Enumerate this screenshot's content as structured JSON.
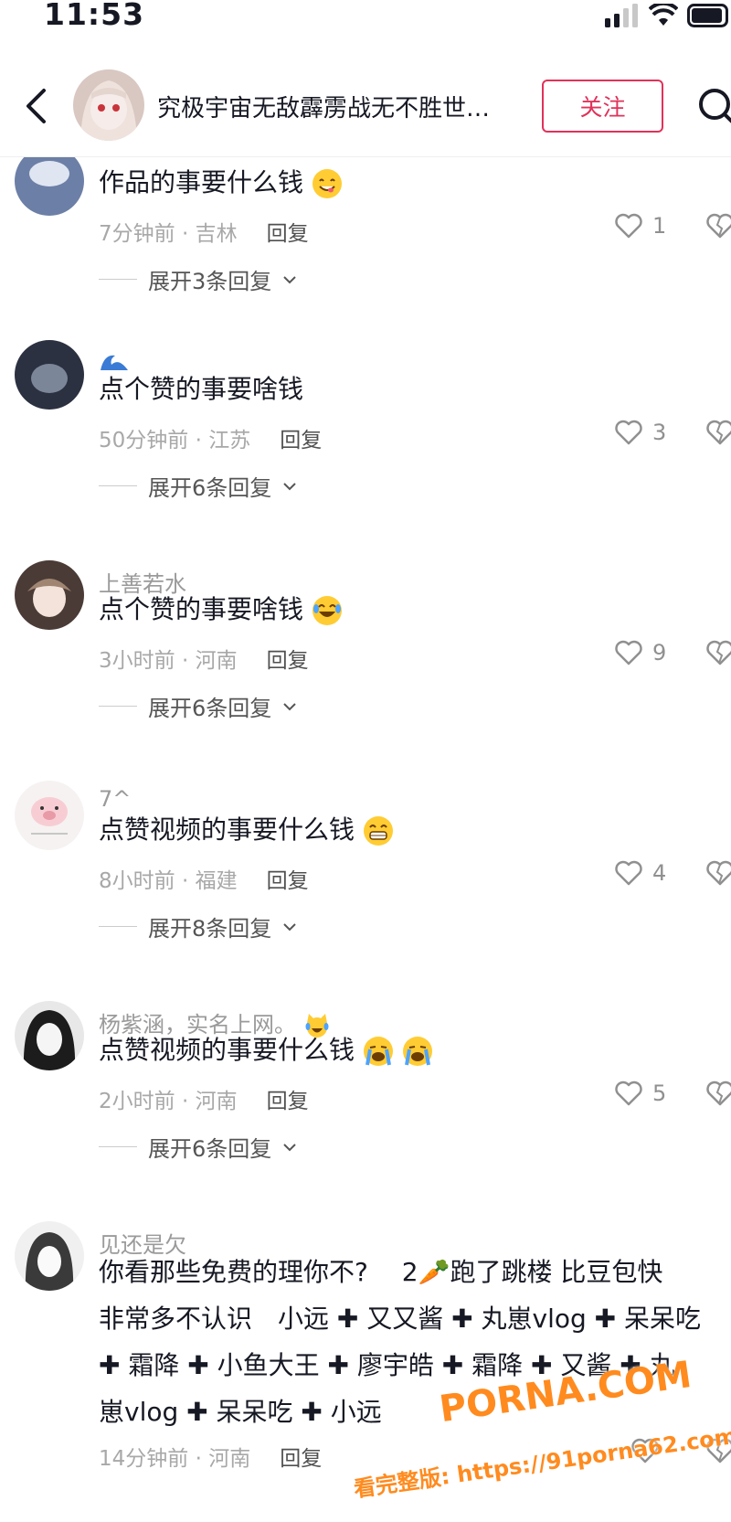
{
  "status_bar": {
    "time": "11:53"
  },
  "header": {
    "title": "究极宇宙无敌霹雳战无不胜世…",
    "follow_label": "关注"
  },
  "comments": [
    {
      "name": "",
      "text": "作品的事要什么钱",
      "emoji": "yum",
      "time": "7分钟前 · 吉林",
      "reply": "回复",
      "likes": "1",
      "expand": "展开3条回复"
    },
    {
      "name": "",
      "name_emoji": "wave",
      "text": "点个赞的事要啥钱",
      "time": "50分钟前 · 江苏",
      "reply": "回复",
      "likes": "3",
      "expand": "展开6条回复"
    },
    {
      "name": "上善若水",
      "text": "点个赞的事要啥钱",
      "emoji": "laugh-cry",
      "time": "3小时前 · 河南",
      "reply": "回复",
      "likes": "9",
      "expand": "展开6条回复"
    },
    {
      "name": "7^",
      "text": "点赞视频的事要什么钱",
      "emoji": "grin",
      "time": "8小时前 · 福建",
      "reply": "回复",
      "likes": "4",
      "expand": "展开8条回复"
    },
    {
      "name": "杨紫涵，实名上网。",
      "name_emoji": "laugh-cry-cat",
      "text": "点赞视频的事要什么钱",
      "emoji": "loud-cry",
      "time": "2小时前 · 河南",
      "reply": "回复",
      "likes": "5",
      "expand": "展开6条回复"
    },
    {
      "name": "见还是欠",
      "text_lines": [
        "你看那些免费的理你不?　 2🥕跑了跳楼 比豆包快",
        "非常多不认识　小远 ✚ 又又酱 ✚ 丸崽vlog ✚ 呆呆吃",
        "✚ 霜降 ✚ 小鱼大王 ✚ 廖宇皓 ✚ 霜降 ✚ 又酱 ✚ 丸",
        "崽vlog ✚ 呆呆吃 ✚ 小远"
      ],
      "time": "14分钟前 · 河南",
      "reply": "回复",
      "likes": ""
    }
  ],
  "watermark": {
    "brand": "PORNA.COM",
    "line": "看完整版: https://91porna62.com"
  },
  "colors": {
    "accent": "#e0325a",
    "watermark": "#ff8b1f"
  }
}
